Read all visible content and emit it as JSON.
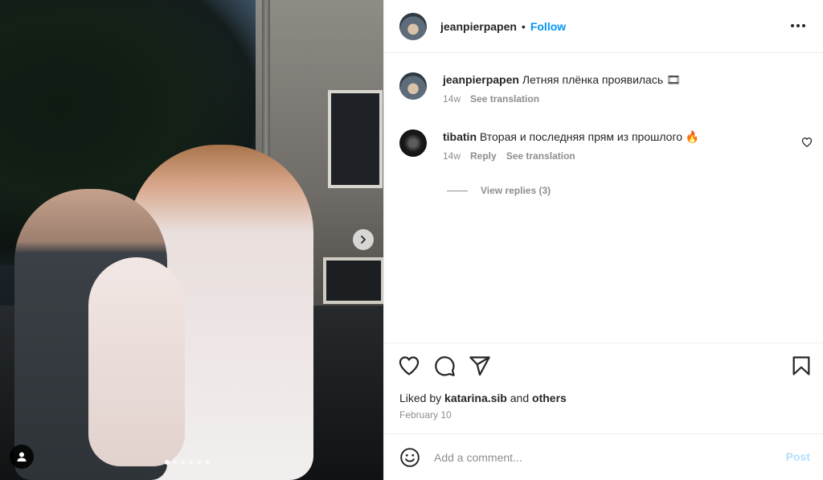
{
  "post": {
    "author": "jeanpierpapen",
    "follow_label": "Follow",
    "separator": "•",
    "carousel": {
      "slide_count": 6,
      "active_index": 0
    }
  },
  "caption": {
    "username": "jeanpierpapen",
    "text": "Летняя плёнка проявилась 🎞",
    "time": "14w",
    "see_translation": "See translation"
  },
  "comments": [
    {
      "username": "tibatin",
      "text": "Вторая и последняя прям из прошлого 🔥",
      "time": "14w",
      "reply_label": "Reply",
      "see_translation": "See translation",
      "view_replies": "View replies (3)"
    }
  ],
  "likes": {
    "prefix": "Liked by",
    "user": "katarina.sib",
    "connector": "and",
    "others": "others"
  },
  "date": "February 10",
  "add_comment": {
    "placeholder": "Add a comment...",
    "post_label": "Post"
  },
  "icons": {
    "more": "more-options-icon",
    "next": "chevron-right-icon",
    "tagged": "user-tag-icon",
    "like": "heart-icon",
    "comment": "comment-icon",
    "share": "send-icon",
    "save": "bookmark-icon",
    "emoji": "emoji-icon"
  },
  "colors": {
    "accent": "#0095f6",
    "post_disabled": "#b2dffc",
    "secondary_text": "#8e8e8e"
  }
}
